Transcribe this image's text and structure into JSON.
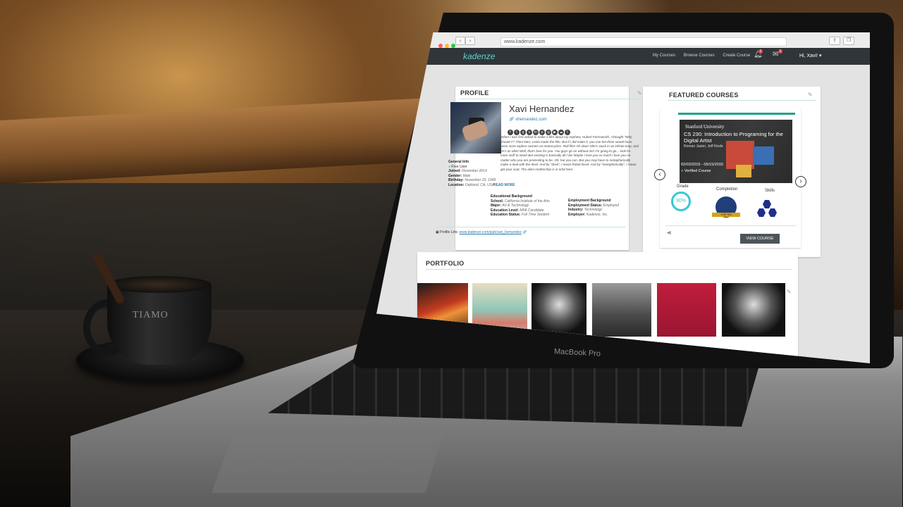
{
  "browser": {
    "url": "www.kadenze.com",
    "nav_back": "‹",
    "nav_forward": "›"
  },
  "app": {
    "logo": "kadenze",
    "nav": [
      "My Courses",
      "Browse Courses",
      "Create Course"
    ],
    "notifications_count": "1",
    "messages_count": "1",
    "user_greeting": "Hi, Xavi!"
  },
  "profile": {
    "section_title": "PROFILE",
    "name": "Xavi Hernandez",
    "website": "xhernandez.com",
    "social_icons": [
      "facebook-icon",
      "twitter-icon",
      "google-plus-icon",
      "vimeo-icon",
      "linkedin-icon",
      "pinterest-icon",
      "instagram-icon",
      "youtube-icon",
      "soundcloud-icon",
      "tumblr-icon"
    ],
    "bio": "When I was first asked to make a film about my nephew, Hubert Farnsworth, I thought \"Why should I?\" Then later, Leela made the film. But if I did make it, you can bet there would have been more topless women on motorcycles. Roll film! Oh dear! She's stuck in an infinite loop, and he's an idiot! Well, that's love for you. You guys go on without me! I'm going to go... look for more stuff to steal! But existing is basically all I do! Maybe I love you so much I love you no matter who you are pretending to be. Oh, but you can. But you may have to metaphorically make a deal with the devil. And by \"devil\", I mean Robot Devil. And by \"metaphorically\", I mean get your coat. The alien mothership is in orbit here.",
    "read_more": "READ MORE",
    "general_info": {
      "heading": "General Info",
      "account": "Free User",
      "joined_label": "Joined:",
      "joined": "November 2014",
      "gender_label": "Gender:",
      "gender": "Male",
      "birthday_label": "Birthday:",
      "birthday": "November 20, 1949",
      "location_label": "Location:",
      "location": "Oakland, CA, USA"
    },
    "education": {
      "heading": "Educational Background",
      "school_label": "School:",
      "school": "California Institute of the Arts",
      "major_label": "Major:",
      "major": "Art & Technology",
      "level_label": "Education Level:",
      "level": "MFA Candidate",
      "status_label": "Education Status:",
      "status": "Full Time Student"
    },
    "employment": {
      "heading": "Employment Background",
      "status_label": "Employment Status:",
      "status": "Employed",
      "industry_label": "Industry:",
      "industry": "Technology",
      "employer_label": "Employer:",
      "employer": "Kadenze, Inc."
    },
    "profile_link_label": "Profile Link:",
    "profile_link": "www.kadenze.com/pub/xavi_hernandez"
  },
  "featured": {
    "section_title": "FEATURED COURSES",
    "university": "Stanford University",
    "course_title": "CS 230: Introduction to Programing for the Digital Artist",
    "instructors": "Roman Jaster, Jeff Kinde",
    "dates": "02/02/2015 - 05/15/2015",
    "verified": "Verified Course",
    "grade_label": "Grade",
    "grade_value": "90%",
    "completion_label": "Completion",
    "completion_badge": "TOP 5%",
    "skills_label": "Skills",
    "view_button": "VIEW COURSE"
  },
  "portfolio": {
    "section_title": "PORTFOLIO",
    "items": [
      "dancer-photo",
      "sculpture-photo",
      "motorcycle-photo",
      "street-photo",
      "poster-photo",
      "motorcycle-photo-2"
    ]
  },
  "scene": {
    "cup_brand": "TIAMO",
    "laptop_brand": "MacBook Pro"
  },
  "colors": {
    "accent": "#1fa38a",
    "link": "#2a7ab0",
    "nav_bg": "#2f3538",
    "grade": "#38c7d3"
  }
}
